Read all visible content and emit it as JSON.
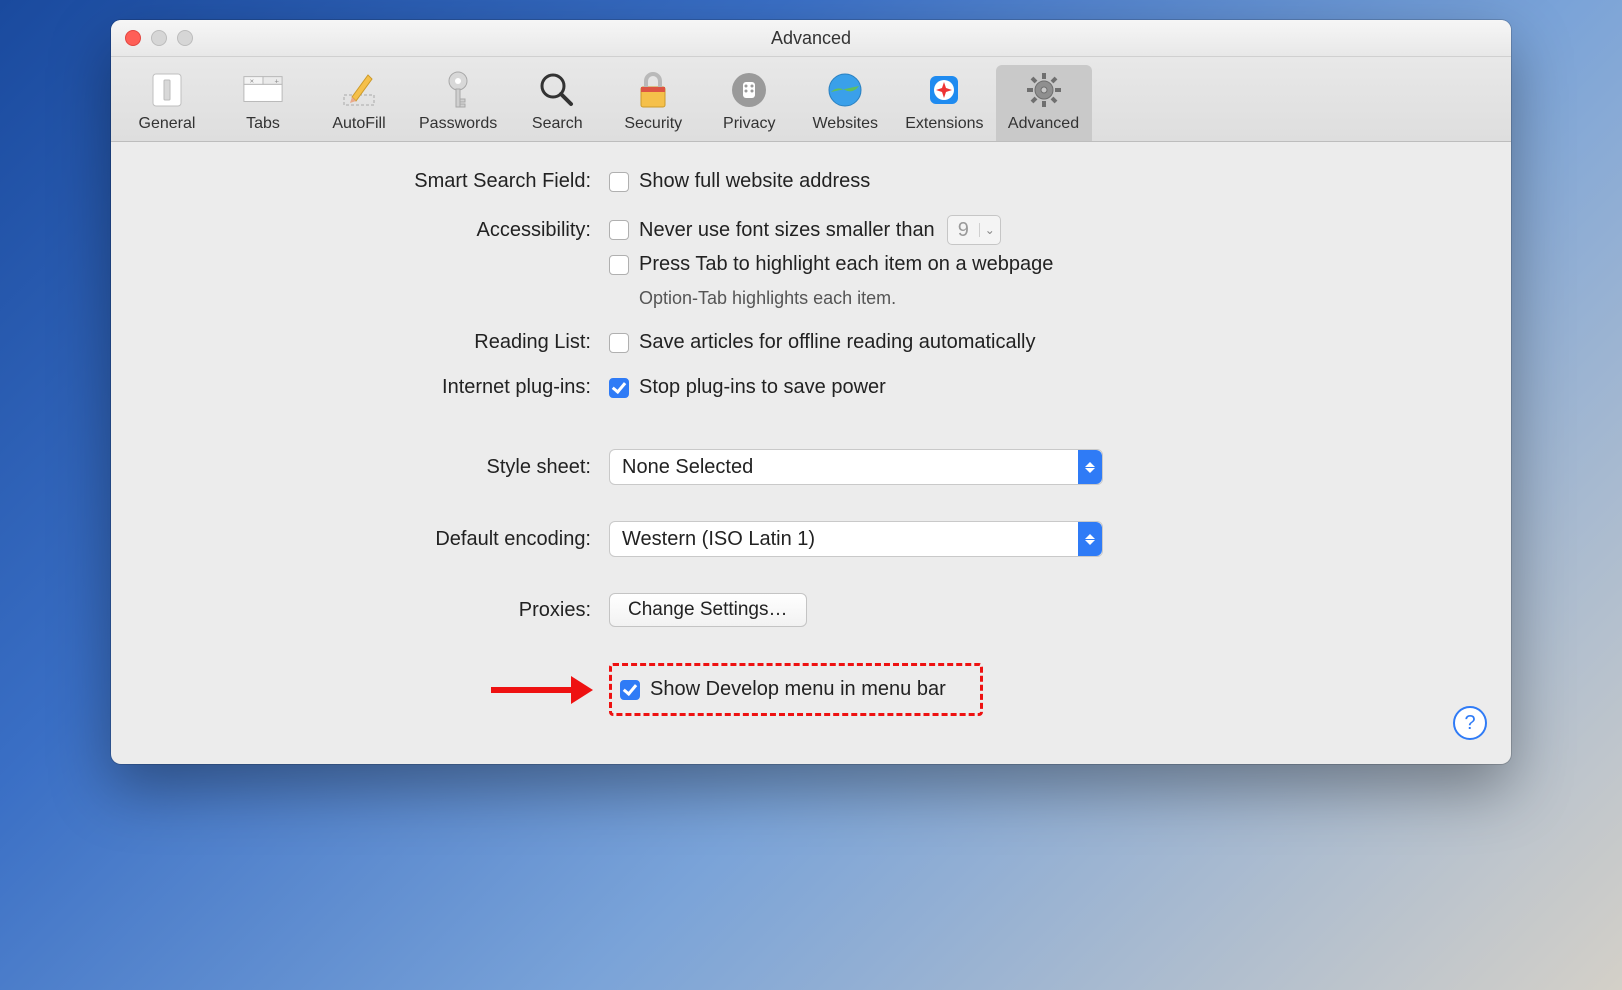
{
  "window": {
    "title": "Advanced"
  },
  "toolbar": {
    "items": [
      {
        "label": "General"
      },
      {
        "label": "Tabs"
      },
      {
        "label": "AutoFill"
      },
      {
        "label": "Passwords"
      },
      {
        "label": "Search"
      },
      {
        "label": "Security"
      },
      {
        "label": "Privacy"
      },
      {
        "label": "Websites"
      },
      {
        "label": "Extensions"
      },
      {
        "label": "Advanced"
      }
    ],
    "selected": "Advanced"
  },
  "sections": {
    "smart_search": {
      "label": "Smart Search Field:",
      "show_full_url": "Show full website address"
    },
    "accessibility": {
      "label": "Accessibility:",
      "min_font": "Never use font sizes smaller than",
      "min_font_value": "9",
      "press_tab": "Press Tab to highlight each item on a webpage",
      "hint": "Option-Tab highlights each item."
    },
    "reading_list": {
      "label": "Reading List:",
      "save_offline": "Save articles for offline reading automatically"
    },
    "plugins": {
      "label": "Internet plug-ins:",
      "stop_plugins": "Stop plug-ins to save power"
    },
    "style_sheet": {
      "label": "Style sheet:",
      "value": "None Selected"
    },
    "default_encoding": {
      "label": "Default encoding:",
      "value": "Western (ISO Latin 1)"
    },
    "proxies": {
      "label": "Proxies:",
      "button": "Change Settings…"
    },
    "develop": {
      "label": "Show Develop menu in menu bar"
    }
  },
  "help_glyph": "?"
}
